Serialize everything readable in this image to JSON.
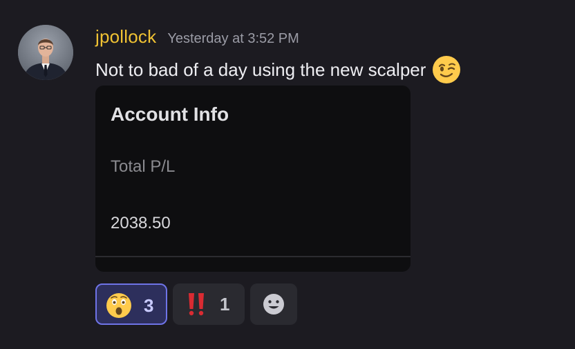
{
  "message": {
    "author": {
      "username": "jpollock",
      "username_color": "#f0c233"
    },
    "timestamp": "Yesterday at 3:52 PM",
    "content": {
      "text": "Not to bad of a day using the new scalper",
      "emoji": "winking-face"
    },
    "embed": {
      "title": "Account Info",
      "field_name": "Total P/L",
      "field_value": "2038.50"
    },
    "reactions": [
      {
        "emoji": "astonished-face",
        "count": "3",
        "selected": true
      },
      {
        "emoji": "double-exclamation-mark",
        "count": "1",
        "selected": false
      },
      {
        "emoji": "add-reaction-smiley",
        "count": null,
        "selected": false
      }
    ]
  },
  "colors": {
    "background": "#1c1b21",
    "embed_background": "#0e0e10",
    "accent_border": "#6f74e8",
    "selected_reaction_bg": "#2d2f5c"
  }
}
